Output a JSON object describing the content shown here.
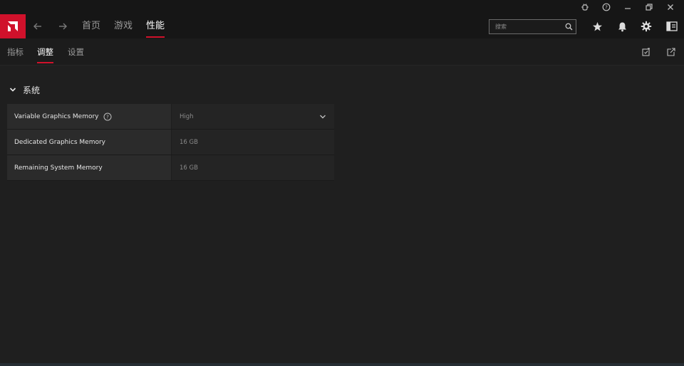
{
  "titlebar": {
    "icons": [
      "bug-report-icon",
      "help-icon",
      "minimize-icon",
      "restore-icon",
      "close-icon"
    ]
  },
  "navbar": {
    "logo": "amd-logo",
    "tabs": [
      {
        "label": "首页",
        "active": false
      },
      {
        "label": "游戏",
        "active": false
      },
      {
        "label": "性能",
        "active": true
      }
    ],
    "search": {
      "placeholder": "搜索",
      "value": ""
    },
    "icons": [
      "star-icon",
      "bell-icon",
      "gear-icon",
      "sidebar-panel-icon"
    ]
  },
  "subnav": {
    "tabs": [
      {
        "label": "指标",
        "active": false
      },
      {
        "label": "调整",
        "active": true
      },
      {
        "label": "设置",
        "active": false
      }
    ],
    "icons": [
      "edit-check-icon",
      "export-icon"
    ]
  },
  "section": {
    "title": "系统",
    "rows": [
      {
        "label": "Variable Graphics Memory",
        "value": "High",
        "has_help": true,
        "dropdown": true
      },
      {
        "label": "Dedicated Graphics Memory",
        "value": "16 GB",
        "has_help": false,
        "dropdown": false
      },
      {
        "label": "Remaining System Memory",
        "value": "16 GB",
        "has_help": false,
        "dropdown": false
      }
    ]
  },
  "colors": {
    "accent": "#d0112b",
    "background": "#1f1f1f",
    "bar": "#161616"
  }
}
